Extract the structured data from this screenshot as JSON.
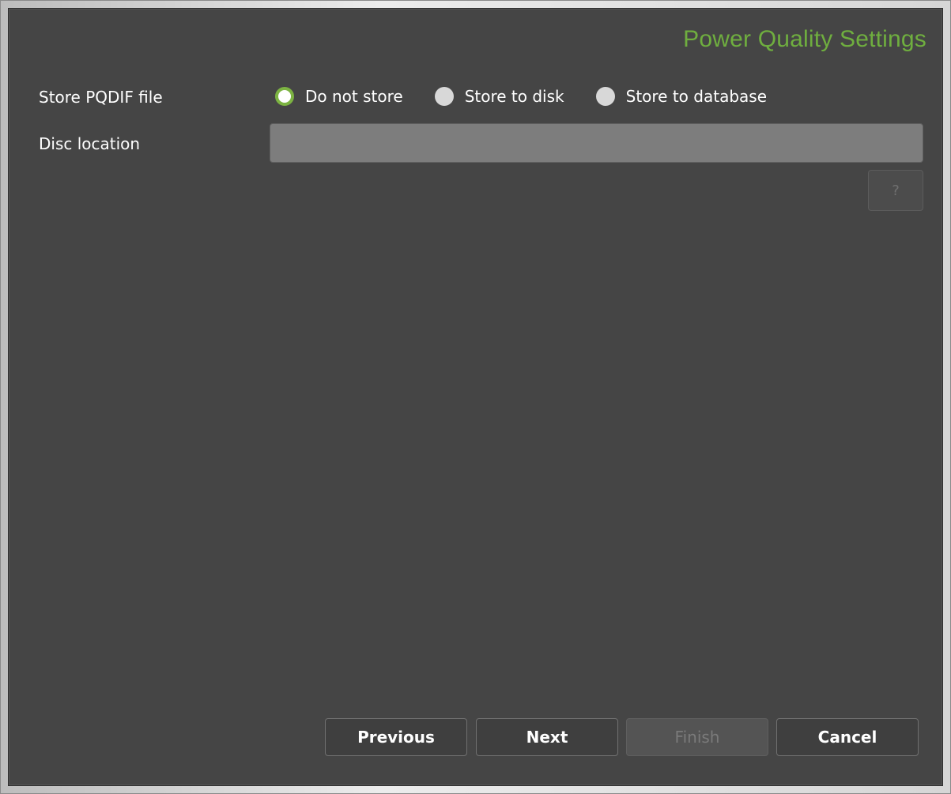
{
  "header": {
    "title": "Power Quality Settings"
  },
  "form": {
    "store_label": "Store PQDIF file",
    "store_options": [
      {
        "label": "Do not store",
        "selected": true
      },
      {
        "label": "Store to disk",
        "selected": false
      },
      {
        "label": "Store to database",
        "selected": false
      }
    ],
    "disc_label": "Disc location",
    "disc_value": "",
    "help_label": "?"
  },
  "footer": {
    "previous_label": "Previous",
    "next_label": "Next",
    "finish_label": "Finish",
    "cancel_label": "Cancel"
  },
  "colors": {
    "accent": "#6fae3f",
    "panel_bg": "#454545"
  }
}
